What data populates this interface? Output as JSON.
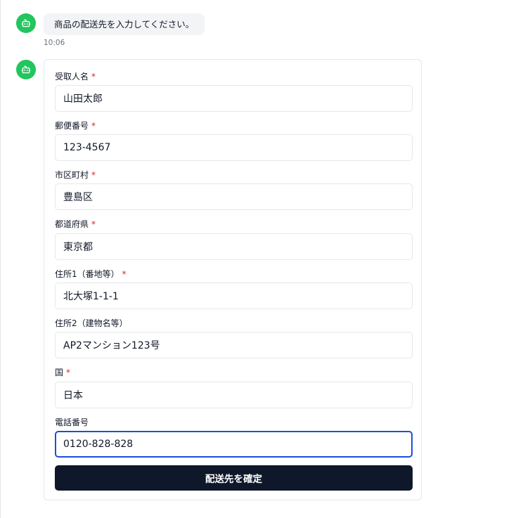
{
  "message": {
    "text": "商品の配送先を入力してください。",
    "time": "10:06"
  },
  "colors": {
    "avatar": "#22c55e",
    "required": "#dc2626",
    "focus_border": "#1d4ed8",
    "submit_bg": "#0f172a"
  },
  "icons": {
    "avatar": "bot-icon"
  },
  "form": {
    "fields": [
      {
        "label": "受取人名",
        "required_mark": "*",
        "value": "山田太郎"
      },
      {
        "label": "郵便番号",
        "required_mark": "*",
        "value": "123-4567"
      },
      {
        "label": "市区町村",
        "required_mark": "*",
        "value": "豊島区"
      },
      {
        "label": "都道府県",
        "required_mark": "*",
        "value": "東京都"
      },
      {
        "label": "住所1（番地等）",
        "required_mark": "*",
        "value": "北大塚1-1-1"
      },
      {
        "label": "住所2（建物名等）",
        "value": "AP2マンション123号"
      },
      {
        "label": "国",
        "required_mark": "*",
        "value": "日本"
      },
      {
        "label": "電話番号",
        "value": "0120-828-828"
      }
    ],
    "submit_label": "配送先を確定"
  }
}
